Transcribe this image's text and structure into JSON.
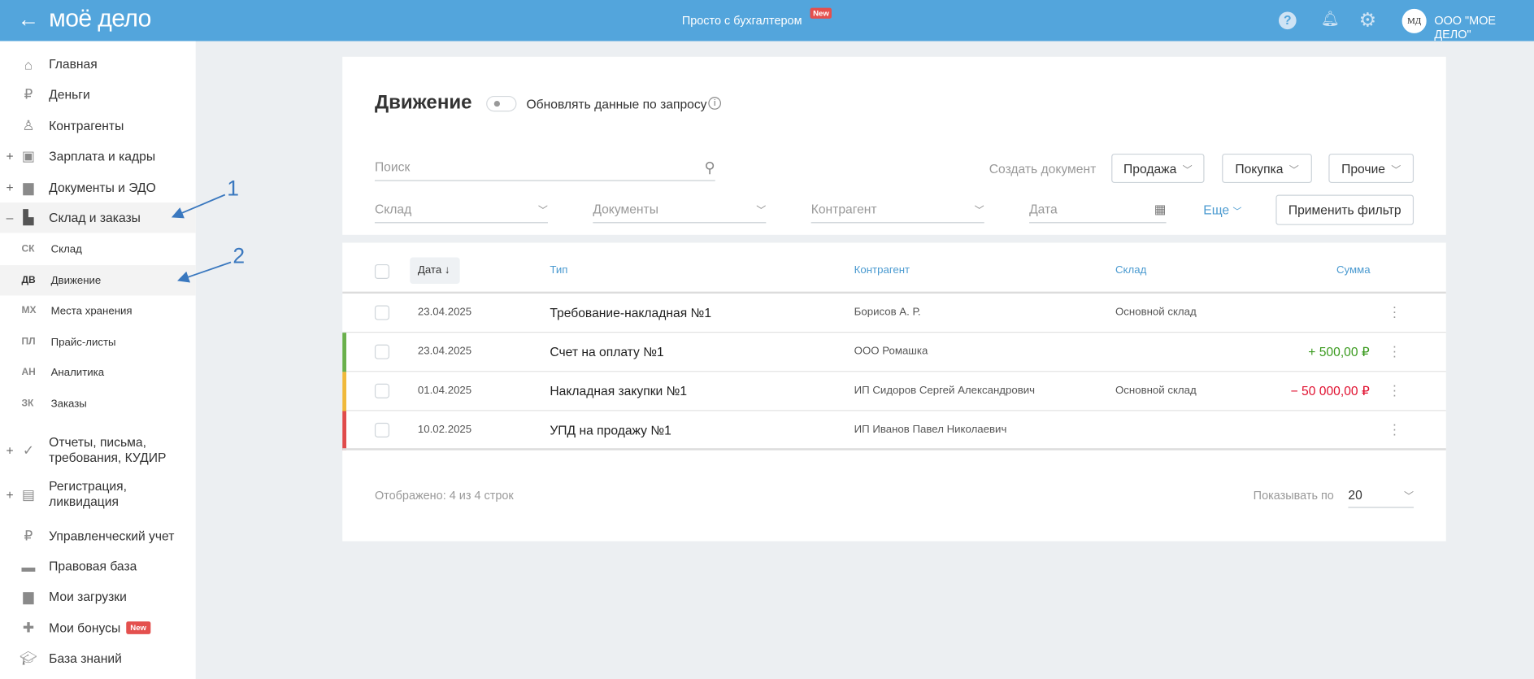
{
  "header": {
    "logo": "моё дело",
    "center_link": "Просто с бухгалтером",
    "center_badge": "New",
    "avatar": "МД",
    "org": "ООО \"МОЕ ДЕЛО\""
  },
  "sidebar": {
    "items": [
      {
        "label": "Главная",
        "icon": "home-icon"
      },
      {
        "label": "Деньги",
        "icon": "money-icon"
      },
      {
        "label": "Контрагенты",
        "icon": "person-icon"
      },
      {
        "label": "Зарплата и кадры",
        "icon": "wallet-icon",
        "pm": "+"
      },
      {
        "label": "Документы и ЭДО",
        "icon": "folder-icon",
        "pm": "+"
      },
      {
        "label": "Склад и заказы",
        "icon": "warehouse-icon",
        "pm": "–"
      }
    ],
    "subitems": [
      {
        "abbr": "СК",
        "label": "Склад"
      },
      {
        "abbr": "ДВ",
        "label": "Движение"
      },
      {
        "abbr": "МХ",
        "label": "Места хранения"
      },
      {
        "abbr": "ПЛ",
        "label": "Прайс-листы"
      },
      {
        "abbr": "АН",
        "label": "Аналитика"
      },
      {
        "abbr": "ЗК",
        "label": "Заказы"
      }
    ],
    "items2": [
      {
        "label": "Отчеты, письма, требования, КУДИР",
        "pm": "+"
      },
      {
        "label": "Регистрация, ликвидация",
        "pm": "+"
      },
      {
        "label": "Управленческий учет"
      },
      {
        "label": "Правовая база"
      },
      {
        "label": "Мои загрузки"
      },
      {
        "label": "Мои бонусы",
        "badge": "New"
      },
      {
        "label": "База знаний"
      }
    ]
  },
  "annotations": [
    "1",
    "2"
  ],
  "main": {
    "title": "Движение",
    "toggle_label": "Обновлять данные по запросу",
    "toggle_on": false,
    "search_placeholder": "Поиск",
    "create_label": "Создать документ",
    "buttons": [
      "Продажа",
      "Покупка",
      "Прочие"
    ],
    "filters": {
      "sklad": "Склад",
      "docs": "Документы",
      "kontragent": "Контрагент",
      "date": "Дата",
      "more": "Еще",
      "apply": "Применить фильтр"
    },
    "table": {
      "headers": [
        "Дата",
        "Тип",
        "Контрагент",
        "Склад",
        "Сумма"
      ],
      "rows": [
        {
          "date": "23.04.2025",
          "type": "Требование-накладная №1",
          "kontragent": "Борисов А. Р.",
          "sklad": "Основной склад",
          "sum": "",
          "color": ""
        },
        {
          "date": "23.04.2025",
          "type": "Счет на оплату №1",
          "kontragent": "ООО Ромашка",
          "sklad": "",
          "sum": "+ 500,00 ₽",
          "color": "#6ab04c"
        },
        {
          "date": "01.04.2025",
          "type": "Накладная закупки №1",
          "kontragent": "ИП Сидоров Сергей Александрович",
          "sklad": "Основной склад",
          "sum": "− 50 000,00 ₽",
          "color": "#f0b93b"
        },
        {
          "date": "10.02.2025",
          "type": "УПД на продажу №1",
          "kontragent": "ИП Иванов Павел Николаевич",
          "sklad": "",
          "sum": "",
          "color": "#e04b4b"
        }
      ]
    },
    "footer": {
      "shown": "Отображено: 4 из 4 строк",
      "per_page_label": "Показывать по",
      "per_page": "20"
    }
  }
}
